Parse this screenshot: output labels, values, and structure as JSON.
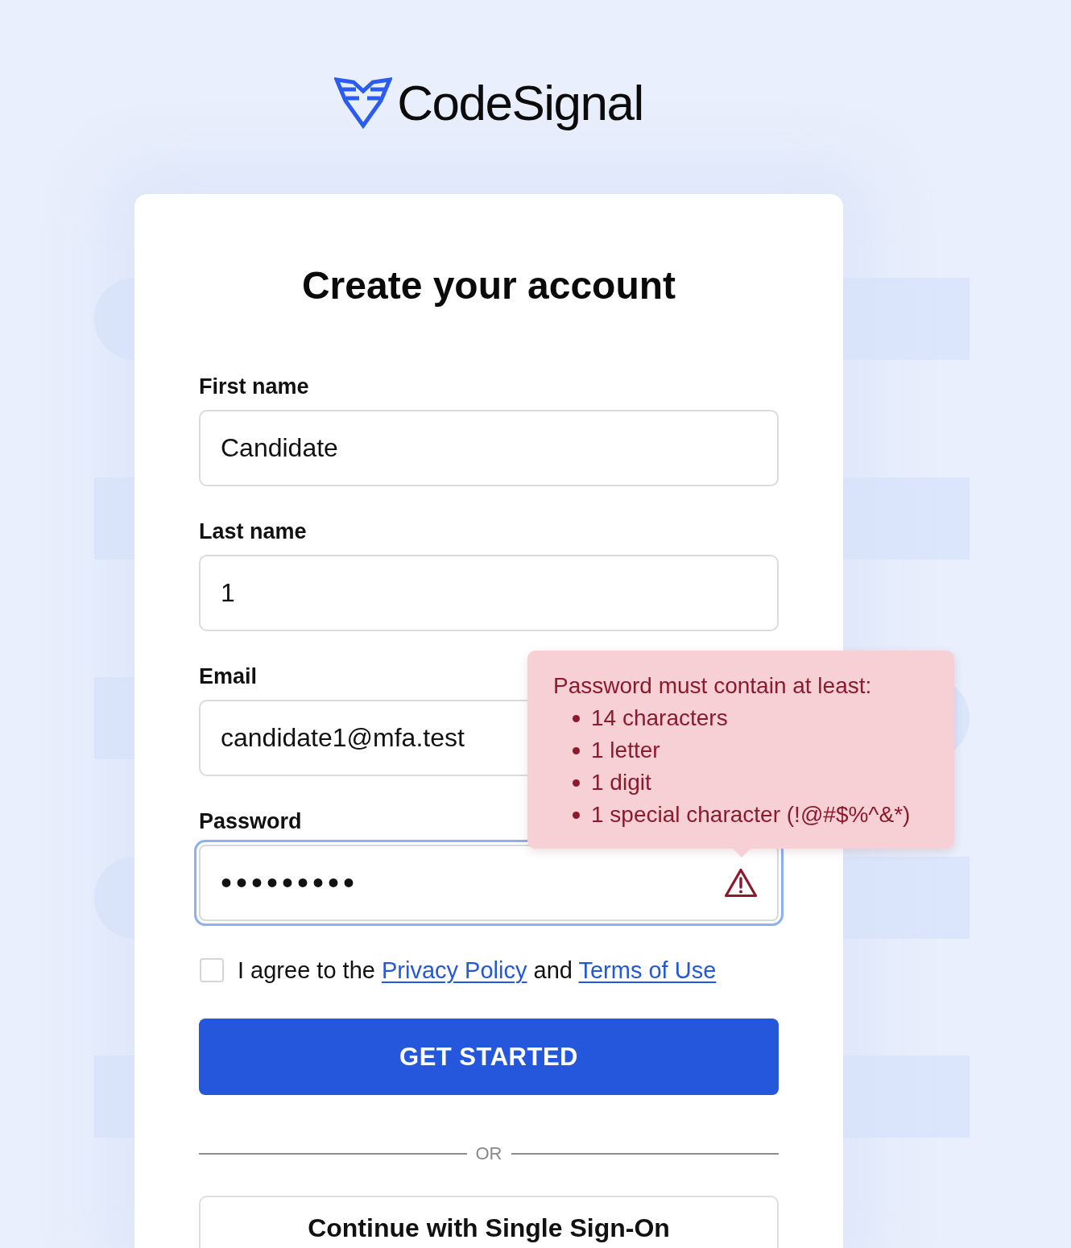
{
  "logo": {
    "text": "CodeSignal"
  },
  "title": "Create your account",
  "fields": [
    {
      "kind": "text",
      "label": "First name",
      "value": "Candidate",
      "focused": false,
      "invalid": false
    },
    {
      "kind": "text",
      "label": "Last name",
      "value": "1",
      "focused": false,
      "invalid": false
    },
    {
      "kind": "text",
      "label": "Email",
      "value": "candidate1@mfa.test",
      "focused": false,
      "invalid": false
    },
    {
      "kind": "password",
      "label": "Password",
      "value": "•••••••••",
      "focused": true,
      "invalid": true
    }
  ],
  "password_hint": {
    "heading": "Password must contain at least:",
    "items": [
      "14 characters",
      "1 letter",
      "1 digit",
      "1 special character (!@#$%^&*)"
    ]
  },
  "agreement": {
    "checked": false,
    "segments": [
      {
        "kind": "text",
        "text": "I agree to the"
      },
      {
        "kind": "link",
        "text": "Privacy Policy"
      },
      {
        "kind": "text",
        "text": "and"
      },
      {
        "kind": "link",
        "text": "Terms of Use"
      }
    ]
  },
  "primary_button": "GET STARTED",
  "divider": "OR",
  "sso_button": "Continue with Single Sign-On"
}
